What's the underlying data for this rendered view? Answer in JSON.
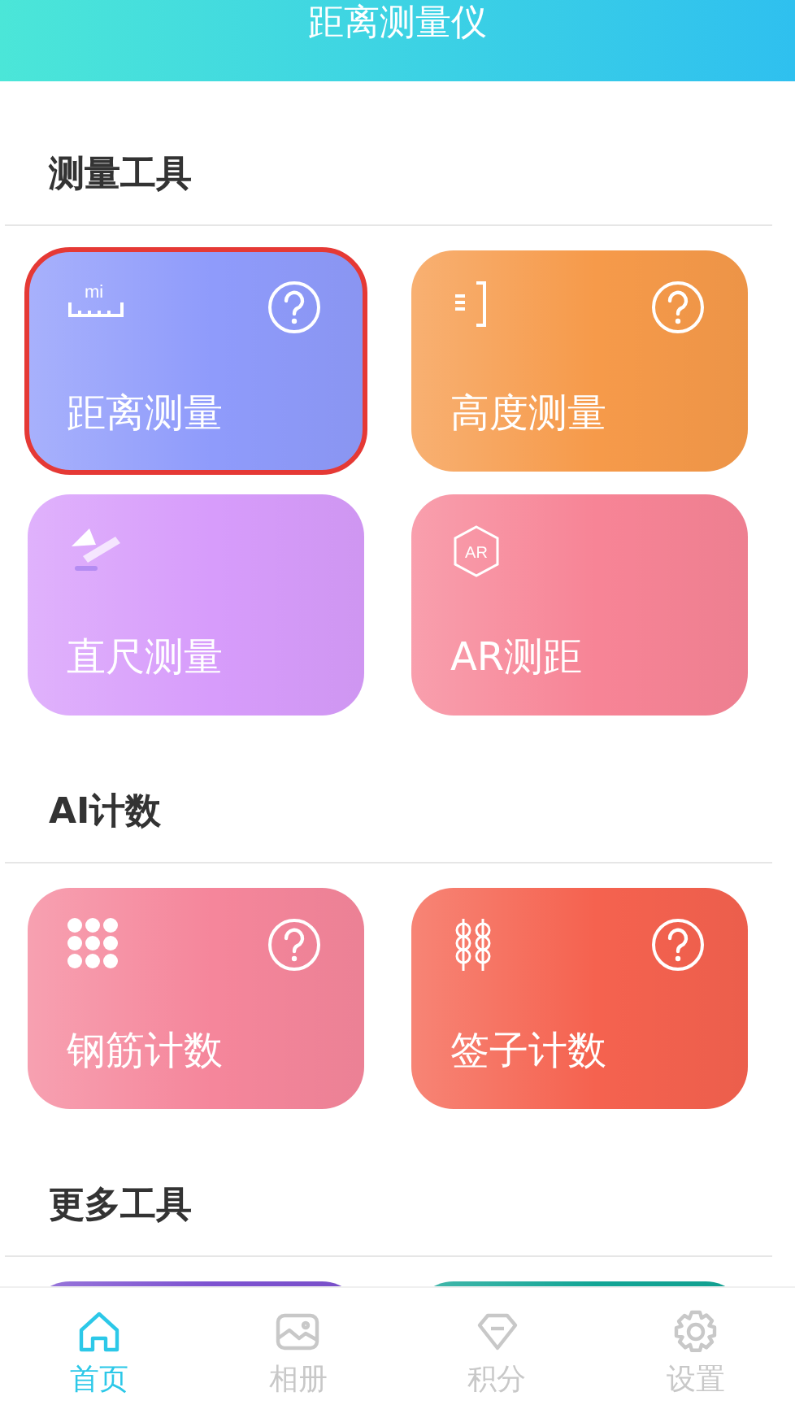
{
  "header": {
    "title": "距离测量仪"
  },
  "sections": [
    {
      "title": "测量工具",
      "cards": [
        {
          "title": "距离测量",
          "kind": "ruler",
          "icon_label": "mi",
          "help": true,
          "highlighted": true,
          "color": "#8f9bfb"
        },
        {
          "title": "高度测量",
          "kind": "height",
          "help": true,
          "highlighted": false,
          "color": "#f69a4a"
        },
        {
          "title": "直尺测量",
          "kind": "triangle",
          "help": false,
          "highlighted": false,
          "color": "#d79cfb"
        },
        {
          "title": "AR测距",
          "kind": "ar",
          "icon_label": "AR",
          "help": false,
          "highlighted": false,
          "color": "#f78496"
        }
      ]
    },
    {
      "title": "AI计数",
      "cards": [
        {
          "title": "钢筋计数",
          "kind": "dots",
          "help": true,
          "highlighted": false,
          "color": "#f5869b"
        },
        {
          "title": "签子计数",
          "kind": "skewers",
          "help": true,
          "highlighted": false,
          "color": "#f5624f"
        }
      ]
    },
    {
      "title": "更多工具",
      "cards": [
        {
          "color": "#7d52d0",
          "help": false,
          "highlighted": false
        },
        {
          "color": "#12a595",
          "help": false,
          "highlighted": false
        }
      ]
    }
  ],
  "nav": [
    {
      "label": "首页",
      "kind": "home",
      "selected": true
    },
    {
      "label": "相册",
      "kind": "image",
      "selected": false
    },
    {
      "label": "积分",
      "kind": "gem",
      "selected": false
    },
    {
      "label": "设置",
      "kind": "gear",
      "selected": false
    }
  ]
}
